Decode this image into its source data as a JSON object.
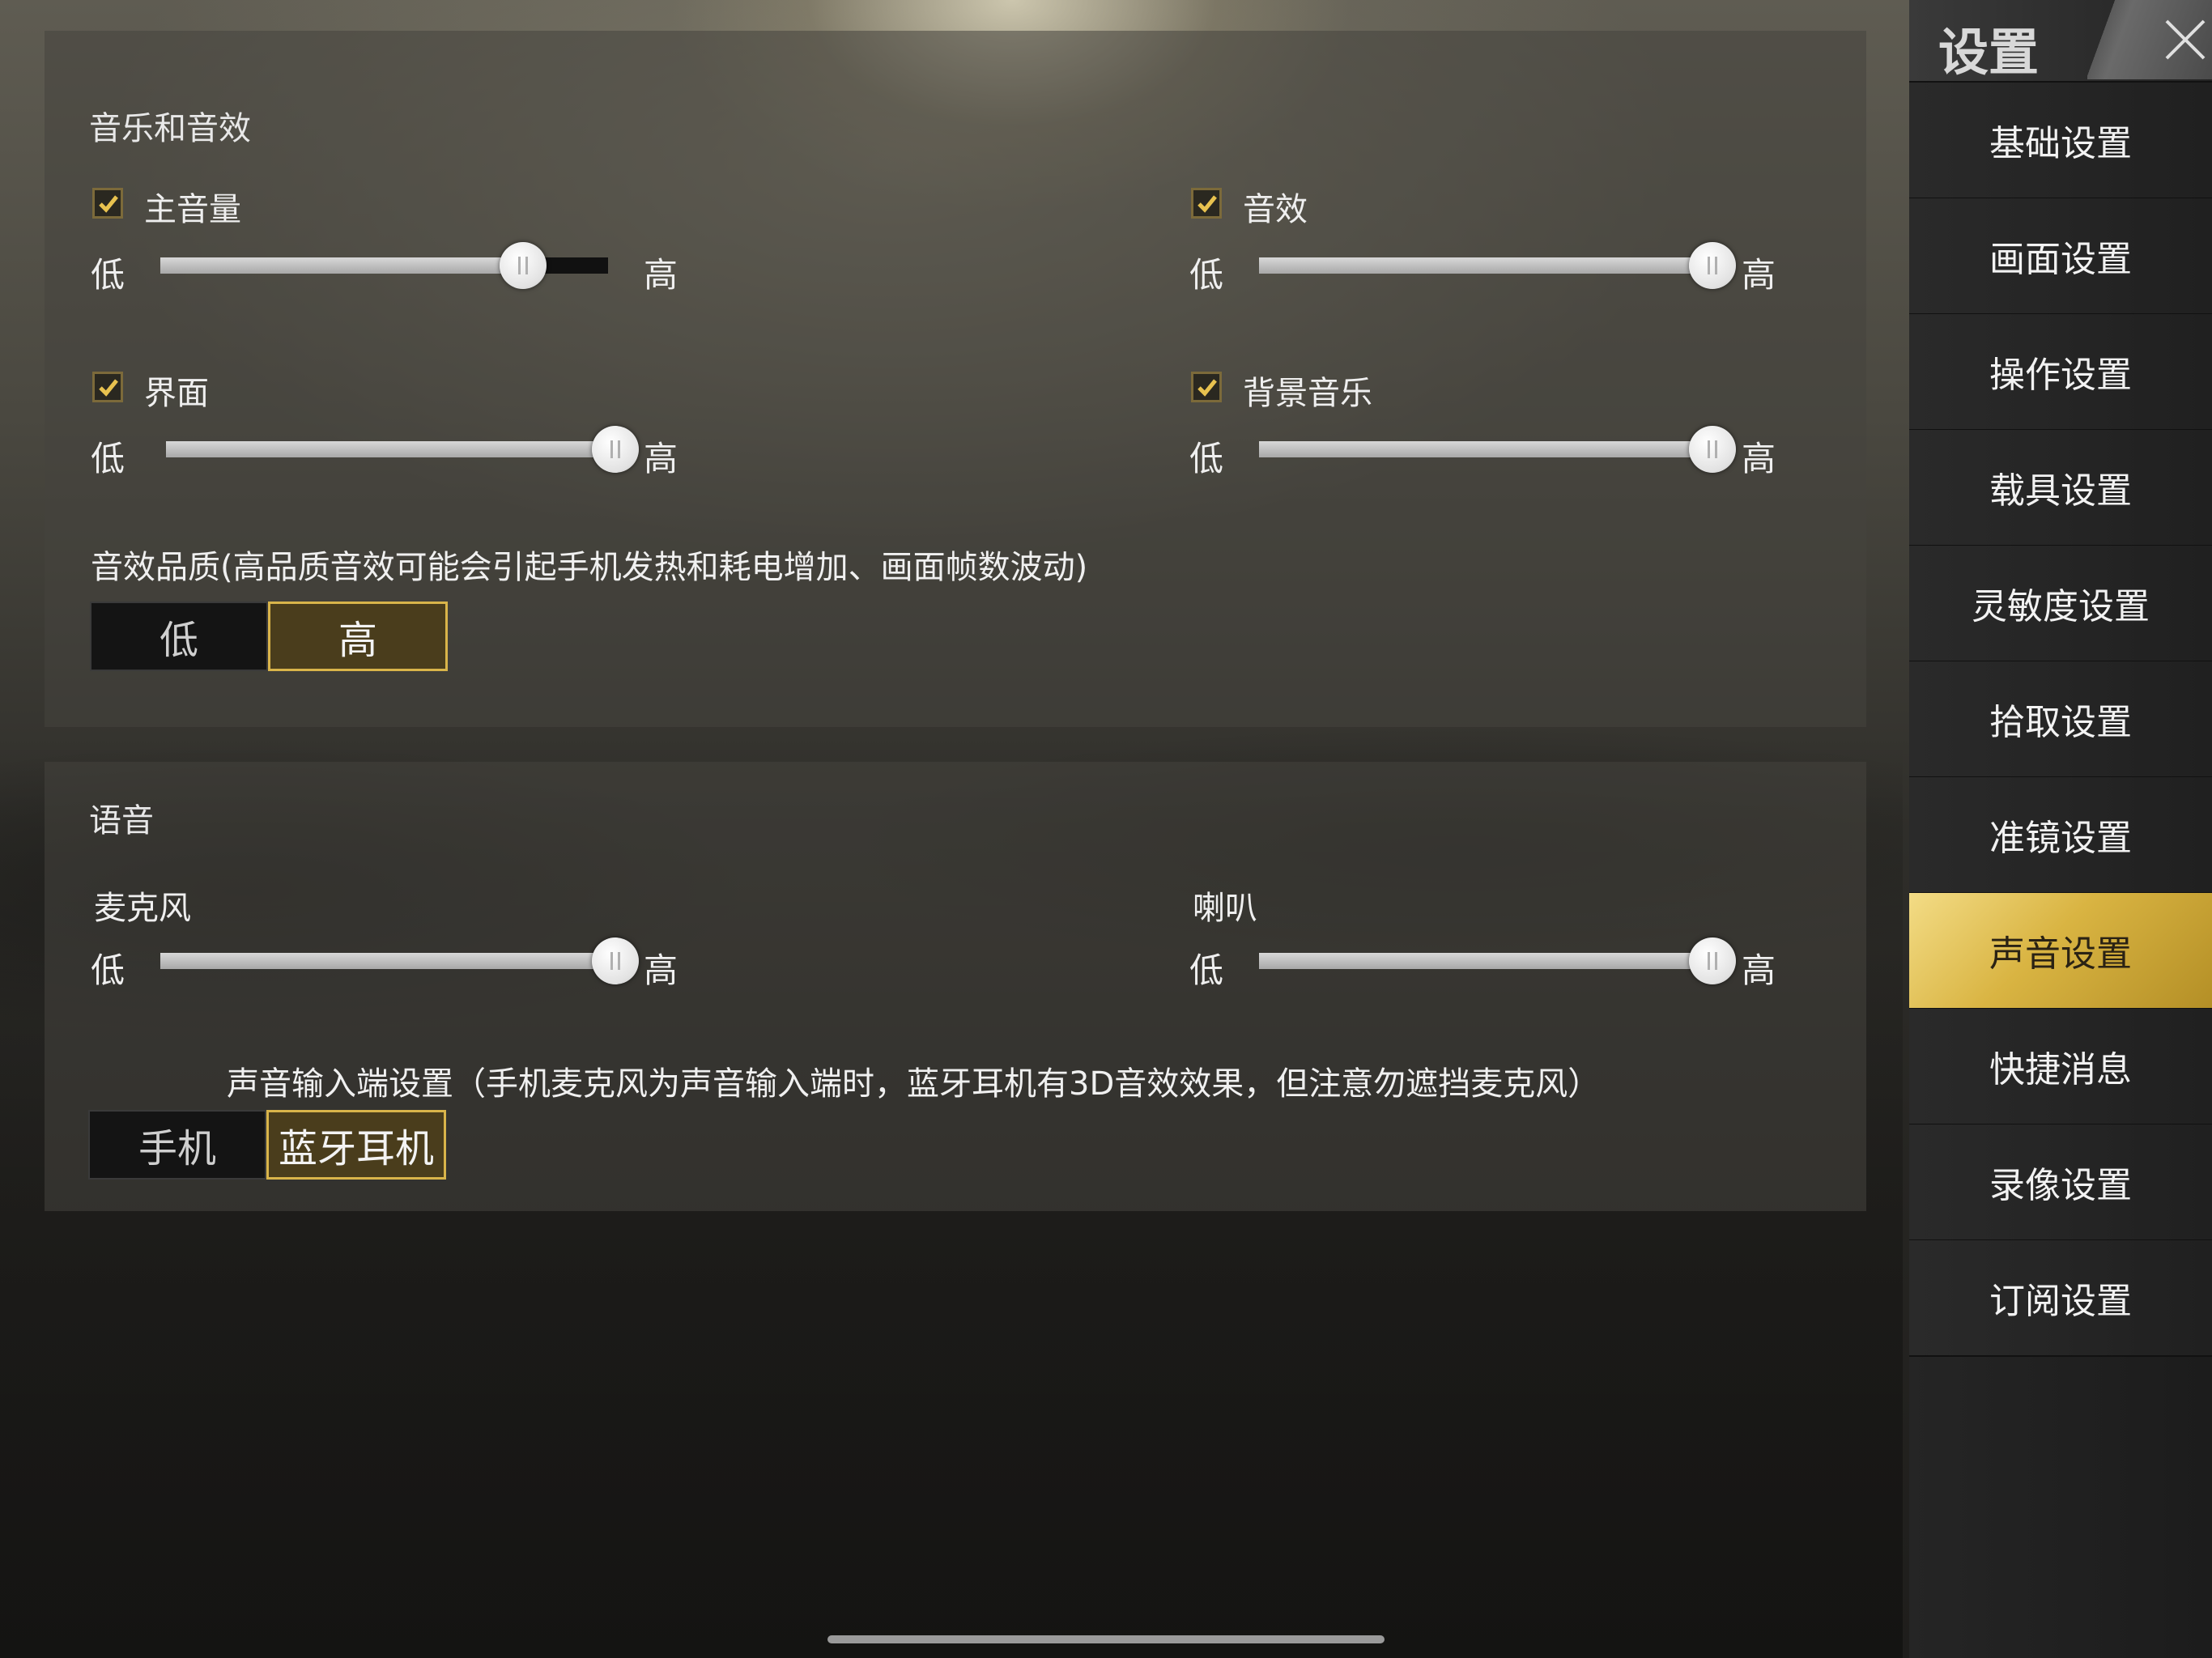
{
  "music": {
    "title": "音乐和音效",
    "master_volume": {
      "label": "主音量",
      "checked": true,
      "low": "低",
      "high": "高",
      "value_fraction": 0.81
    },
    "sfx": {
      "label": "音效",
      "checked": true,
      "low": "低",
      "high": "高",
      "value_fraction": 1.0
    },
    "interface": {
      "label": "界面",
      "checked": true,
      "low": "低",
      "high": "高",
      "value_fraction": 1.0
    },
    "bgm": {
      "label": "背景音乐",
      "checked": true,
      "low": "低",
      "high": "高",
      "value_fraction": 1.0
    },
    "quality_label": "音效品质(高品质音效可能会引起手机发热和耗电增加、画面帧数波动)",
    "quality_options": [
      "低",
      "高"
    ],
    "quality_selected": "高"
  },
  "voice": {
    "title": "语音",
    "microphone": {
      "label": "麦克风",
      "low": "低",
      "high": "高",
      "value_fraction": 1.0
    },
    "speaker": {
      "label": "喇叭",
      "low": "低",
      "high": "高",
      "value_fraction": 1.0
    },
    "input_desc": "声音输入端设置（手机麦克风为声音输入端时，蓝牙耳机有3D音效效果，但注意勿遮挡麦克风）",
    "input_options": [
      "手机",
      "蓝牙耳机"
    ],
    "input_selected": "蓝牙耳机"
  },
  "sidebar": {
    "title": "设置",
    "close_icon": "close-icon",
    "items": [
      {
        "label": "基础设置",
        "active": false
      },
      {
        "label": "画面设置",
        "active": false
      },
      {
        "label": "操作设置",
        "active": false
      },
      {
        "label": "载具设置",
        "active": false
      },
      {
        "label": "灵敏度设置",
        "active": false
      },
      {
        "label": "拾取设置",
        "active": false
      },
      {
        "label": "准镜设置",
        "active": false
      },
      {
        "label": "声音设置",
        "active": true
      },
      {
        "label": "快捷消息",
        "active": false
      },
      {
        "label": "录像设置",
        "active": false
      },
      {
        "label": "订阅设置",
        "active": false
      }
    ]
  },
  "colors": {
    "accent_gold": "#d9b44a",
    "active_tab": "#e0bd4e"
  }
}
